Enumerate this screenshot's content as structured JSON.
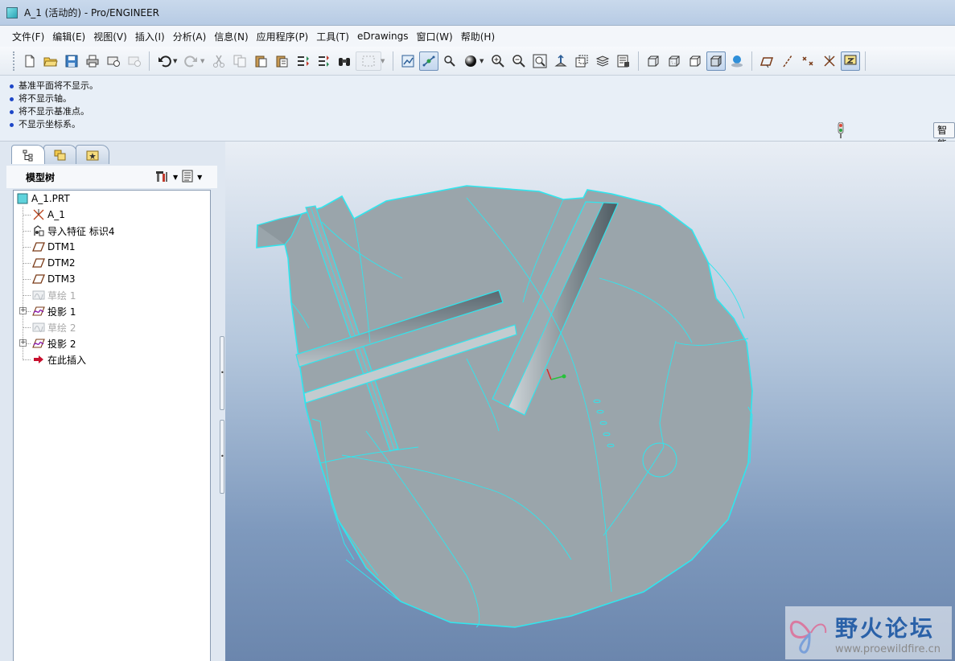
{
  "window": {
    "title": "A_1 (活动的) - Pro/ENGINEER"
  },
  "menu": [
    "文件(F)",
    "编辑(E)",
    "视图(V)",
    "插入(I)",
    "分析(A)",
    "信息(N)",
    "应用程序(P)",
    "工具(T)",
    "eDrawings",
    "窗口(W)",
    "帮助(H)"
  ],
  "messages": [
    "基准平面将不显示。",
    "将不显示轴。",
    "将不显示基准点。",
    "不显示坐标系。"
  ],
  "smart_filter": "智能",
  "model_tree": {
    "title": "模型树",
    "items": [
      {
        "label": "A_1.PRT",
        "icon": "part-icon",
        "dim": false
      },
      {
        "label": "A_1",
        "icon": "csys-icon",
        "dim": false
      },
      {
        "label": "导入特征 标识4",
        "icon": "import-feature-icon",
        "dim": false
      },
      {
        "label": "DTM1",
        "icon": "datum-plane-icon",
        "dim": false
      },
      {
        "label": "DTM2",
        "icon": "datum-plane-icon",
        "dim": false
      },
      {
        "label": "DTM3",
        "icon": "datum-plane-icon",
        "dim": false
      },
      {
        "label": "草绘 1",
        "icon": "sketch-icon",
        "dim": true
      },
      {
        "label": "投影 1",
        "icon": "projection-icon",
        "dim": false
      },
      {
        "label": "草绘 2",
        "icon": "sketch-icon",
        "dim": true
      },
      {
        "label": "投影 2",
        "icon": "projection-icon",
        "dim": false
      },
      {
        "label": "在此插入",
        "icon": "insert-here-arrow-icon",
        "dim": false
      }
    ]
  },
  "watermark": {
    "name": "野火论坛",
    "url": "www.proewildfire.cn"
  }
}
